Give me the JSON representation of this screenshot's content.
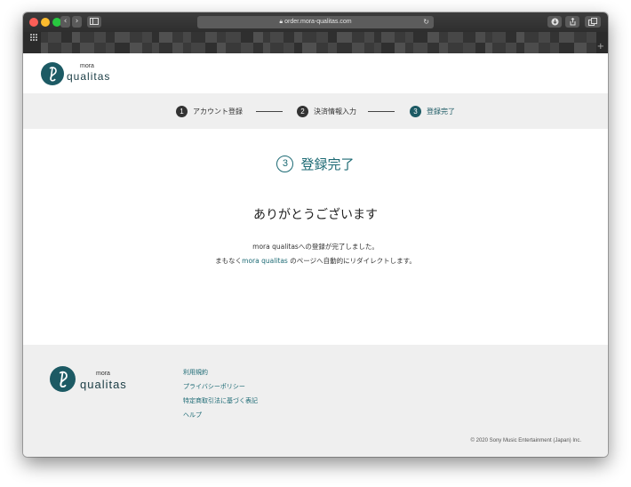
{
  "browser": {
    "url": "order.mora-qualitas.com",
    "lock_icon": "lock-icon",
    "reload_icon": "reload-icon",
    "download_icon": "download-icon",
    "share_icon": "share-icon",
    "tabs_icon": "tabs-icon",
    "grid_icon": "grid-icon",
    "add_tab_icon": "plus-icon"
  },
  "logo": {
    "mora": "mora",
    "qualitas": "qualitas"
  },
  "steps": [
    {
      "num": "1",
      "label": "アカウント登録",
      "active": false
    },
    {
      "num": "2",
      "label": "決済情報入力",
      "active": false
    },
    {
      "num": "3",
      "label": "登録完了",
      "active": true
    }
  ],
  "colors": {
    "accent": "#1c5a64",
    "footer_bg": "#efefef",
    "steps_bg": "#efefef"
  },
  "main": {
    "step_num": "3",
    "step_title": "登録完了",
    "thanks": "ありがとうございます",
    "line1": "mora qualitasへの登録が完了しました。",
    "line2_pre": "まもなく",
    "line2_link": "mora qualitas",
    "line2_post": " のページへ自動的にリダイレクトします。"
  },
  "footer": {
    "links": [
      "利用規約",
      "プライバシーポリシー",
      "特定商取引法に基づく表記",
      "ヘルプ"
    ],
    "copyright": "© 2020 Sony Music Entertainment (Japan) Inc."
  }
}
